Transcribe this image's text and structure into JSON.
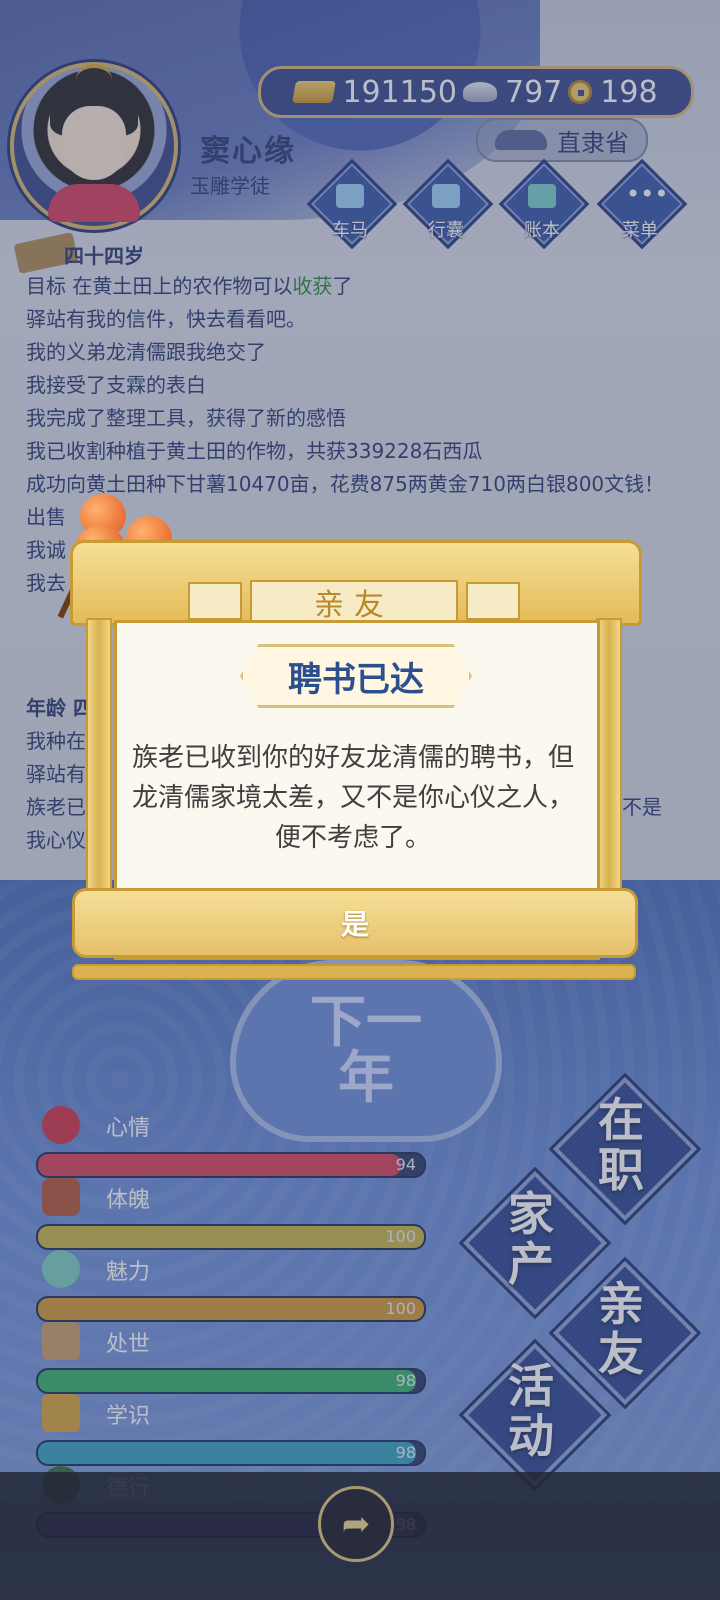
{
  "player": {
    "name": "窦心缘",
    "title": "玉雕学徒"
  },
  "currency": {
    "gold": "191150",
    "silver": "797",
    "coin": "198"
  },
  "location": "直隶省",
  "nav": [
    "车马",
    "行囊",
    "账本",
    "菜单"
  ],
  "log": {
    "age_header": "四十四岁",
    "goal_prefix": "目标 在黄土田上的农作物可以",
    "goal_highlight": "收获",
    "goal_suffix": "了",
    "lines": [
      "驿站有我的信件，快去看看吧。",
      "我的义弟龙清儒跟我绝交了",
      "我接受了支霖的表白",
      "我完成了整理工具，获得了新的感悟",
      "我已收割种植于黄土田的作物，共获339228石西瓜",
      "成功向黄土田种下甘薯10470亩，花费875两黄金710两白银800文钱！",
      "出售",
      "我诚",
      "我去"
    ],
    "age2_header": "年龄 四",
    "lines2": [
      "我种在",
      "驿站有",
      "族老已",
      "我心仪"
    ],
    "line2_tail": "不是"
  },
  "next_year": [
    "下一",
    "年"
  ],
  "stats": [
    {
      "name": "心情",
      "value": 94,
      "max": 100,
      "color": "#d9485f"
    },
    {
      "name": "体魄",
      "value": 100,
      "max": 100,
      "color": "#c9b84a"
    },
    {
      "name": "魅力",
      "value": 100,
      "max": 100,
      "color": "#d39a3a"
    },
    {
      "name": "处世",
      "value": 98,
      "max": 100,
      "color": "#3bb36a"
    },
    {
      "name": "学识",
      "value": 98,
      "max": 100,
      "color": "#3aa3c0"
    },
    {
      "name": "德行",
      "value": 98,
      "max": 100,
      "color": "#6b4aa8"
    }
  ],
  "side_buttons": [
    {
      "top": "在",
      "bottom": "职"
    },
    {
      "top": "家",
      "bottom": "产"
    },
    {
      "top": "亲",
      "bottom": "友"
    },
    {
      "top": "活",
      "bottom": "动"
    }
  ],
  "dialog": {
    "header": "亲友",
    "title": "聘书已达",
    "message": "族老已收到你的好友龙清儒的聘书，但龙清儒家境太差，又不是你心仪之人，便不考虑了。",
    "confirm": "是"
  }
}
